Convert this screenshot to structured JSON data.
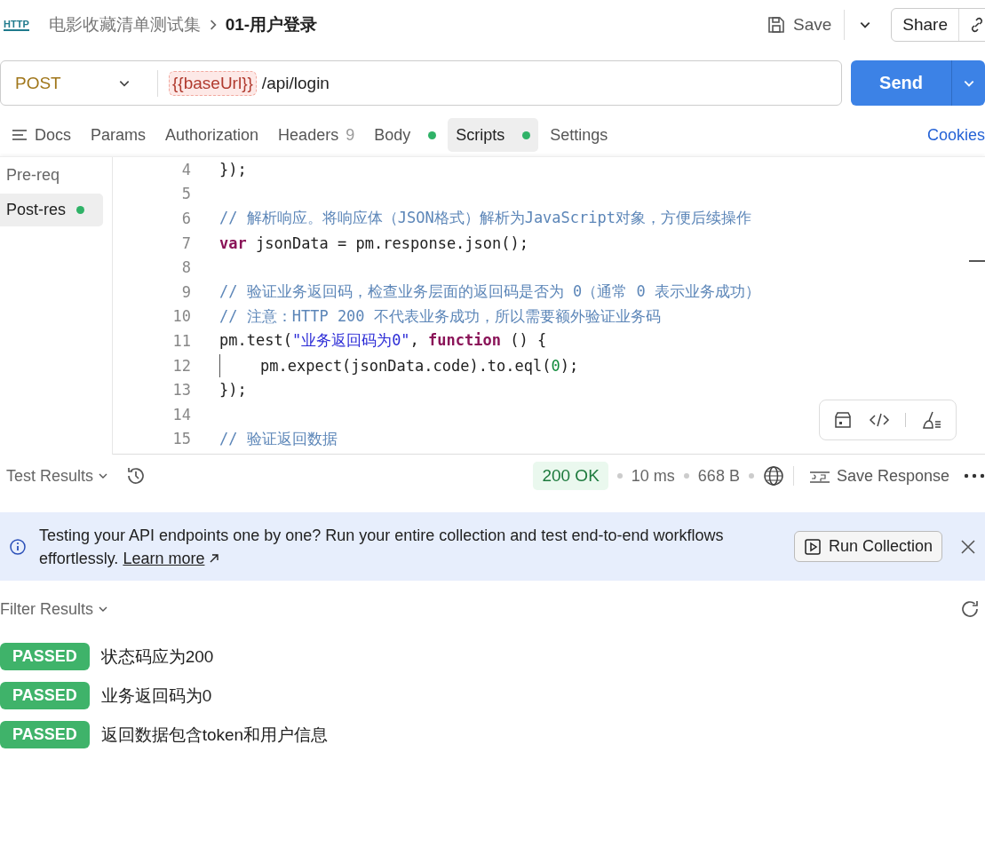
{
  "header": {
    "protocol_icon_text": "HTTP",
    "breadcrumb": [
      "电影收藏清单测试集",
      "01-用户登录"
    ],
    "save": "Save",
    "share": "Share"
  },
  "request": {
    "method": "POST",
    "url_variable": "{{baseUrl}}",
    "url_path": "/api/login",
    "send": "Send"
  },
  "tabs": [
    {
      "label": "Docs",
      "selected": false,
      "kind": "docs"
    },
    {
      "label": "Params",
      "selected": false,
      "kind": "plain"
    },
    {
      "label": "Authorization",
      "selected": false,
      "kind": "plain"
    },
    {
      "label": "Headers",
      "count": "9",
      "selected": false,
      "kind": "count"
    },
    {
      "label": "Body",
      "selected": false,
      "kind": "dot"
    },
    {
      "label": "Scripts",
      "selected": true,
      "kind": "dot"
    },
    {
      "label": "Settings",
      "selected": false,
      "kind": "plain"
    }
  ],
  "cookies": "Cookies",
  "script_phases": [
    {
      "label": "Pre-req",
      "selected": false,
      "has_script": false
    },
    {
      "label": "Post-res",
      "selected": true,
      "has_script": true
    }
  ],
  "code_lines": [
    {
      "number": "4",
      "indent_guide": false,
      "tokens": [
        {
          "kind": "plain",
          "text": "});"
        }
      ]
    },
    {
      "number": "5",
      "indent_guide": false
    },
    {
      "number": "6",
      "indent_guide": false,
      "tokens": [
        {
          "kind": "comment",
          "text": "// 解析响应。将响应体（JSON格式）解析为JavaScript对象，方便后续操作"
        }
      ]
    },
    {
      "number": "7",
      "indent_guide": false,
      "tokens": [
        {
          "kind": "keyword",
          "text": "var"
        },
        {
          "kind": "plain",
          "text": " jsonData = pm.response.json();"
        }
      ]
    },
    {
      "number": "8",
      "indent_guide": false
    },
    {
      "number": "9",
      "indent_guide": false,
      "tokens": [
        {
          "kind": "comment",
          "text": "// 验证业务返回码，检查业务层面的返回码是否为 0（通常 0 表示业务成功）"
        }
      ]
    },
    {
      "number": "10",
      "indent_guide": false,
      "tokens": [
        {
          "kind": "comment",
          "text": "// 注意：HTTP 200 不代表业务成功，所以需要额外验证业务码"
        }
      ]
    },
    {
      "number": "11",
      "indent_guide": false,
      "tokens": [
        {
          "kind": "plain",
          "text": "pm.test("
        },
        {
          "kind": "string",
          "text": "\"业务返回码为0\""
        },
        {
          "kind": "plain",
          "text": ", "
        },
        {
          "kind": "keyword",
          "text": "function"
        },
        {
          "kind": "plain",
          "text": " () {"
        }
      ]
    },
    {
      "number": "12",
      "indent_guide": true,
      "tokens": [
        {
          "kind": "plain",
          "text": "pm.expect(jsonData.code).to.eql("
        },
        {
          "kind": "number",
          "text": "0"
        },
        {
          "kind": "plain",
          "text": ");"
        }
      ]
    },
    {
      "number": "13",
      "indent_guide": false,
      "tokens": [
        {
          "kind": "plain",
          "text": "});"
        }
      ]
    },
    {
      "number": "14",
      "indent_guide": false
    },
    {
      "number": "15",
      "indent_guide": false,
      "tokens": [
        {
          "kind": "comment",
          "text": "// 验证返回数据"
        }
      ]
    }
  ],
  "response": {
    "tab": "Test Results",
    "status": "200 OK",
    "time": "10 ms",
    "size": "668 B",
    "save_response": "Save Response"
  },
  "banner": {
    "text": "Testing your API endpoints one by one? Run your entire collection and test end-to-end workflows effortlessly.",
    "link": "Learn more",
    "button": "Run Collection"
  },
  "filter": "Filter Results",
  "results": [
    {
      "status": "PASSED",
      "name": "状态码应为200"
    },
    {
      "status": "PASSED",
      "name": "业务返回码为0"
    },
    {
      "status": "PASSED",
      "name": "返回数据包含token和用户信息"
    }
  ]
}
